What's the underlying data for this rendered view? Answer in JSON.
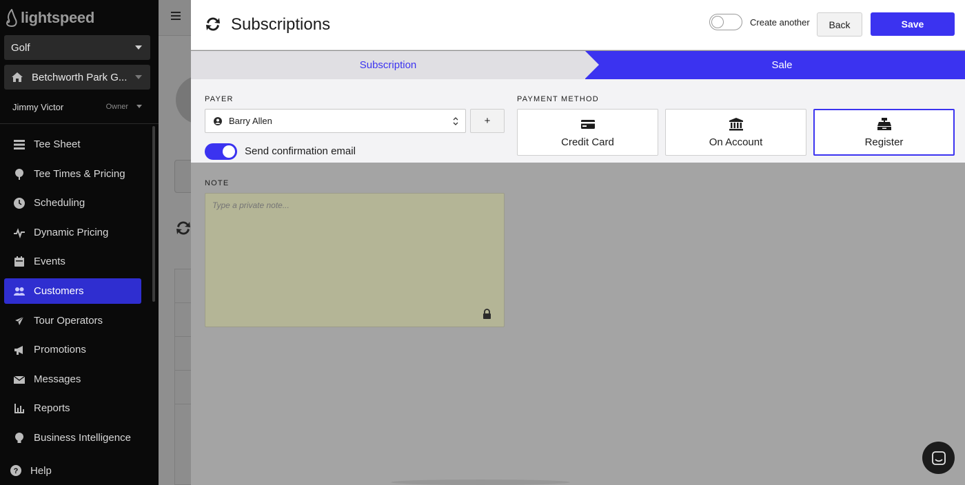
{
  "app": {
    "logo_text": "lightspeed"
  },
  "sidebar": {
    "business_select": "Golf",
    "course_select": "Betchworth Park G...",
    "user_name": "Jimmy Victor",
    "user_role": "Owner",
    "items": [
      {
        "label": "Tee Sheet",
        "icon": "tee-sheet-icon"
      },
      {
        "label": "Tee Times & Pricing",
        "icon": "golf-ball-icon"
      },
      {
        "label": "Scheduling",
        "icon": "clock-icon"
      },
      {
        "label": "Dynamic Pricing",
        "icon": "pulse-icon"
      },
      {
        "label": "Events",
        "icon": "calendar-icon"
      },
      {
        "label": "Customers",
        "icon": "users-icon",
        "active": true
      },
      {
        "label": "Tour Operators",
        "icon": "plane-icon"
      },
      {
        "label": "Promotions",
        "icon": "megaphone-icon"
      },
      {
        "label": "Messages",
        "icon": "envelope-icon"
      },
      {
        "label": "Reports",
        "icon": "chart-icon"
      },
      {
        "label": "Business Intelligence",
        "icon": "lightbulb-icon"
      }
    ],
    "help_label": "Help"
  },
  "modal": {
    "title": "Subscriptions",
    "create_another_label": "Create another",
    "create_another_enabled": false,
    "back_label": "Back",
    "save_label": "Save",
    "steps": [
      {
        "label": "Subscription",
        "state": "done"
      },
      {
        "label": "Sale",
        "state": "current"
      }
    ],
    "payer": {
      "label": "PAYER",
      "value": "Barry Allen",
      "add_label": "+"
    },
    "confirmation": {
      "label": "Send confirmation email",
      "enabled": true
    },
    "payment_method": {
      "label": "PAYMENT METHOD",
      "options": [
        {
          "label": "Credit Card",
          "icon": "credit-card-icon"
        },
        {
          "label": "On Account",
          "icon": "bank-icon"
        },
        {
          "label": "Register",
          "icon": "cash-register-icon",
          "selected": true
        }
      ]
    },
    "note": {
      "label": "NOTE",
      "placeholder": "Type a private note..."
    }
  },
  "colors": {
    "accent": "#3b33f0",
    "sidebar_bg": "#0a0a0a",
    "note_bg": "#b4b596"
  }
}
